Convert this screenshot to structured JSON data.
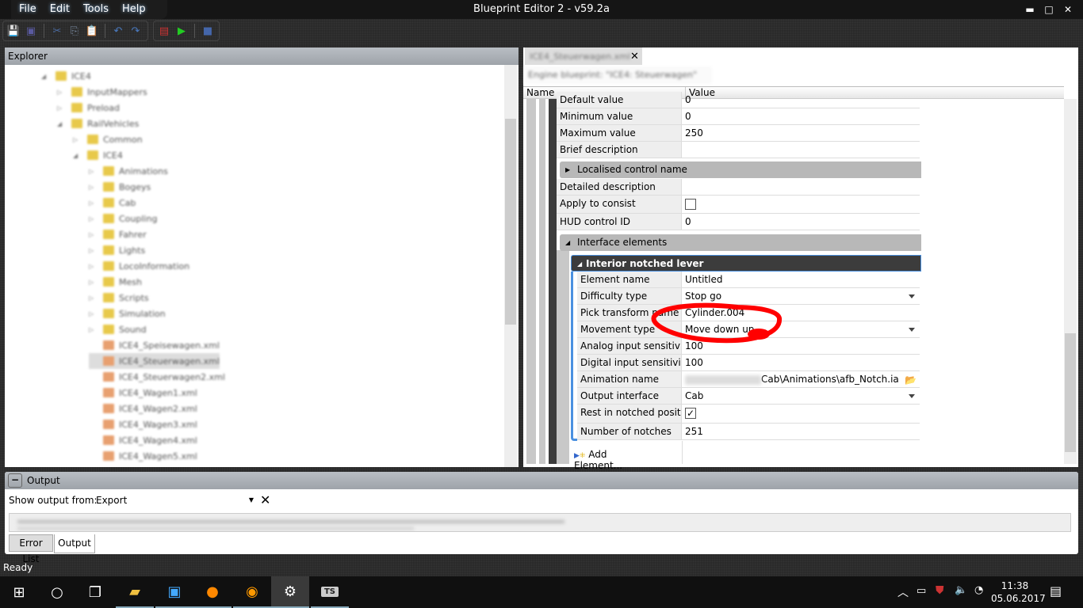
{
  "app": {
    "title": "Blueprint Editor 2 - v59.2a",
    "menu": [
      "File",
      "Edit",
      "Tools",
      "Help"
    ],
    "window_controls": [
      "minimize",
      "maximize",
      "close"
    ]
  },
  "toolbar": {
    "buttons": [
      "save-icon",
      "save-all-icon",
      "cut-icon",
      "copy-icon",
      "paste-icon",
      "undo-icon",
      "redo-icon",
      "export-icon",
      "run-icon",
      "stop-icon"
    ]
  },
  "explorer": {
    "title": "Explorer",
    "items": [
      {
        "label": "ICE4",
        "depth": 0,
        "expanded": true
      },
      {
        "label": "InputMappers",
        "depth": 1
      },
      {
        "label": "Preload",
        "depth": 1
      },
      {
        "label": "RailVehicles",
        "depth": 1,
        "expanded": true
      },
      {
        "label": "Common",
        "depth": 2
      },
      {
        "label": "ICE4",
        "depth": 2,
        "expanded": true
      },
      {
        "label": "Animations",
        "depth": 3
      },
      {
        "label": "Bogeys",
        "depth": 3
      },
      {
        "label": "Cab",
        "depth": 3
      },
      {
        "label": "Coupling",
        "depth": 3
      },
      {
        "label": "Fahrer",
        "depth": 3
      },
      {
        "label": "Lights",
        "depth": 3
      },
      {
        "label": "LocoInformation",
        "depth": 3
      },
      {
        "label": "Mesh",
        "depth": 3
      },
      {
        "label": "Scripts",
        "depth": 3
      },
      {
        "label": "Simulation",
        "depth": 3
      },
      {
        "label": "Sound",
        "depth": 3
      },
      {
        "label": "ICE4_Speisewagen.xml",
        "depth": 3,
        "file": true
      },
      {
        "label": "ICE4_Steuerwagen.xml",
        "depth": 3,
        "file": true,
        "selected": true
      },
      {
        "label": "ICE4_Steuerwagen2.xml",
        "depth": 3,
        "file": true
      },
      {
        "label": "ICE4_Wagen1.xml",
        "depth": 3,
        "file": true
      },
      {
        "label": "ICE4_Wagen2.xml",
        "depth": 3,
        "file": true
      },
      {
        "label": "ICE4_Wagen3.xml",
        "depth": 3,
        "file": true
      },
      {
        "label": "ICE4_Wagen4.xml",
        "depth": 3,
        "file": true
      },
      {
        "label": "ICE4_Wagen5.xml",
        "depth": 3,
        "file": true
      }
    ]
  },
  "document": {
    "tab": "ICE4_Steuerwagen.xml",
    "subtitle": "Engine blueprint: \"ICE4: Steuerwagen\"",
    "columns": {
      "name": "Name",
      "value": "Value"
    },
    "rows_top": [
      {
        "name": "Default value",
        "value": "0"
      },
      {
        "name": "Minimum value",
        "value": "0"
      },
      {
        "name": "Maximum value",
        "value": "250"
      },
      {
        "name": "Brief description",
        "value": ""
      }
    ],
    "group_localised": "Localised control name",
    "rows_mid": [
      {
        "name": "Detailed description",
        "value": ""
      },
      {
        "name": "Apply to consist",
        "value": "",
        "checkbox": false
      },
      {
        "name": "HUD control ID",
        "value": "0"
      }
    ],
    "group_interface": "Interface elements",
    "element_header": "Interior notched lever",
    "element_rows": [
      {
        "name": "Element name",
        "value": "Untitled"
      },
      {
        "name": "Difficulty type",
        "value": "Stop go",
        "dropdown": true
      },
      {
        "name": "Pick transform name",
        "value": "Cylinder.004"
      },
      {
        "name": "Movement type",
        "value": "Move down up",
        "dropdown": true
      },
      {
        "name": "Analog input sensitivity",
        "value": "100"
      },
      {
        "name": "Digital input sensitivity",
        "value": "100"
      },
      {
        "name": "Animation name",
        "value": "Cab\\Animations\\afb_Notch.ia",
        "browse": true
      },
      {
        "name": "Output interface",
        "value": "Cab",
        "dropdown": true
      },
      {
        "name": "Rest in notched positi...",
        "value": "",
        "checkbox": true
      },
      {
        "name": "Number of notches",
        "value": "251"
      }
    ],
    "add_element": "Add Element...",
    "annotation_color": "#ff0000"
  },
  "output": {
    "title": "Output",
    "show_from_label": "Show output from:",
    "show_from_value": "Export",
    "tabs": [
      "Error List",
      "Output"
    ],
    "active_tab": "Output"
  },
  "status": "Ready",
  "taskbar": {
    "apps": [
      "start-icon",
      "cortana-icon",
      "task-view-icon",
      "file-explorer-icon",
      "control-panel-icon",
      "firefox-icon",
      "blender-icon",
      "blueprint-editor-icon",
      "ts-icon"
    ],
    "ts_label": "TS",
    "time": "11:38",
    "date": "05.06.2017"
  }
}
